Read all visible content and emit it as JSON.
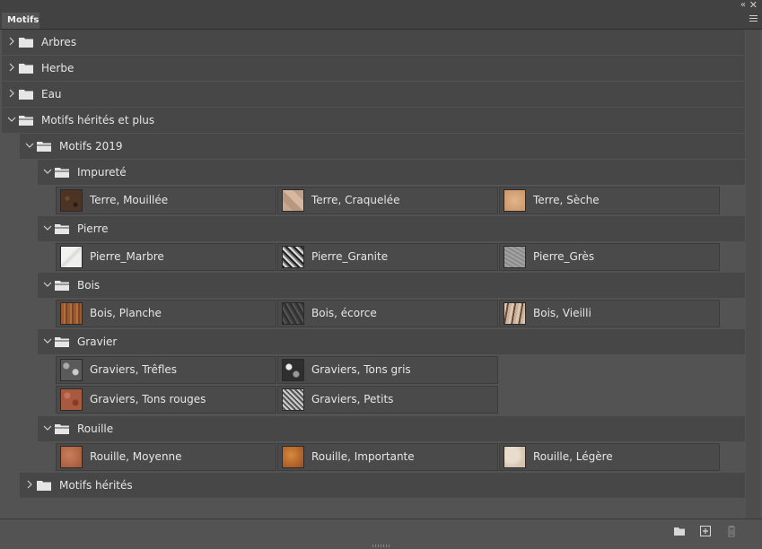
{
  "panel": {
    "tab_label": "Motifs",
    "icons": [
      "collapse-panels-icon",
      "close-icon",
      "panel-menu-icon"
    ]
  },
  "tree": {
    "arbres": "Arbres",
    "herbe": "Herbe",
    "eau": "Eau",
    "motifs_herites_plus": "Motifs hérités et plus",
    "motifs_2019": "Motifs 2019",
    "impurete": "Impureté",
    "pierre": "Pierre",
    "bois": "Bois",
    "gravier": "Gravier",
    "rouille": "Rouille",
    "motifs_herites": "Motifs hérités"
  },
  "patterns": {
    "impurete": [
      "Terre, Mouillée",
      "Terre, Craquelée",
      "Terre, Sèche"
    ],
    "pierre": [
      "Pierre_Marbre",
      "Pierre_Granite",
      "Pierre_Grès"
    ],
    "bois": [
      "Bois, Planche",
      "Bois, écorce",
      "Bois, Vieilli"
    ],
    "gravier": [
      "Graviers, Trêfles",
      "Graviers, Tons gris",
      "Graviers, Tons rouges",
      "Graviers, Petits"
    ],
    "rouille": [
      "Rouille, Moyenne",
      "Rouille, Importante",
      "Rouille, Légère"
    ]
  },
  "footer": {
    "icons": [
      "new-group-icon",
      "new-pattern-icon",
      "trash-icon"
    ]
  }
}
